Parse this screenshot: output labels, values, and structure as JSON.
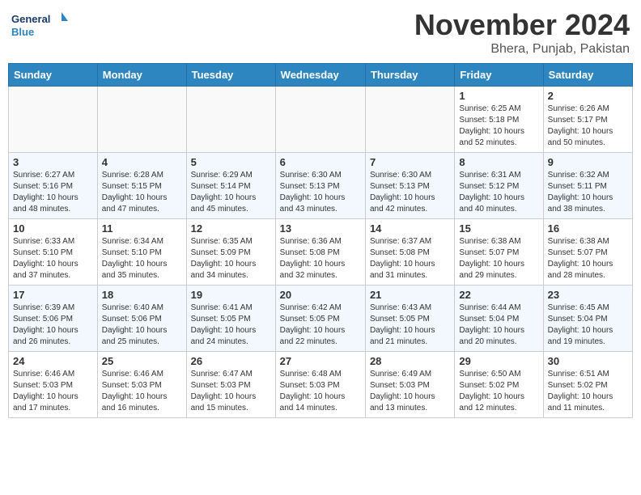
{
  "header": {
    "logo_general": "General",
    "logo_blue": "Blue",
    "month_title": "November 2024",
    "location": "Bhera, Punjab, Pakistan"
  },
  "days_of_week": [
    "Sunday",
    "Monday",
    "Tuesday",
    "Wednesday",
    "Thursday",
    "Friday",
    "Saturday"
  ],
  "weeks": [
    [
      {
        "day": "",
        "info": ""
      },
      {
        "day": "",
        "info": ""
      },
      {
        "day": "",
        "info": ""
      },
      {
        "day": "",
        "info": ""
      },
      {
        "day": "",
        "info": ""
      },
      {
        "day": "1",
        "info": "Sunrise: 6:25 AM\nSunset: 5:18 PM\nDaylight: 10 hours\nand 52 minutes."
      },
      {
        "day": "2",
        "info": "Sunrise: 6:26 AM\nSunset: 5:17 PM\nDaylight: 10 hours\nand 50 minutes."
      }
    ],
    [
      {
        "day": "3",
        "info": "Sunrise: 6:27 AM\nSunset: 5:16 PM\nDaylight: 10 hours\nand 48 minutes."
      },
      {
        "day": "4",
        "info": "Sunrise: 6:28 AM\nSunset: 5:15 PM\nDaylight: 10 hours\nand 47 minutes."
      },
      {
        "day": "5",
        "info": "Sunrise: 6:29 AM\nSunset: 5:14 PM\nDaylight: 10 hours\nand 45 minutes."
      },
      {
        "day": "6",
        "info": "Sunrise: 6:30 AM\nSunset: 5:13 PM\nDaylight: 10 hours\nand 43 minutes."
      },
      {
        "day": "7",
        "info": "Sunrise: 6:30 AM\nSunset: 5:13 PM\nDaylight: 10 hours\nand 42 minutes."
      },
      {
        "day": "8",
        "info": "Sunrise: 6:31 AM\nSunset: 5:12 PM\nDaylight: 10 hours\nand 40 minutes."
      },
      {
        "day": "9",
        "info": "Sunrise: 6:32 AM\nSunset: 5:11 PM\nDaylight: 10 hours\nand 38 minutes."
      }
    ],
    [
      {
        "day": "10",
        "info": "Sunrise: 6:33 AM\nSunset: 5:10 PM\nDaylight: 10 hours\nand 37 minutes."
      },
      {
        "day": "11",
        "info": "Sunrise: 6:34 AM\nSunset: 5:10 PM\nDaylight: 10 hours\nand 35 minutes."
      },
      {
        "day": "12",
        "info": "Sunrise: 6:35 AM\nSunset: 5:09 PM\nDaylight: 10 hours\nand 34 minutes."
      },
      {
        "day": "13",
        "info": "Sunrise: 6:36 AM\nSunset: 5:08 PM\nDaylight: 10 hours\nand 32 minutes."
      },
      {
        "day": "14",
        "info": "Sunrise: 6:37 AM\nSunset: 5:08 PM\nDaylight: 10 hours\nand 31 minutes."
      },
      {
        "day": "15",
        "info": "Sunrise: 6:38 AM\nSunset: 5:07 PM\nDaylight: 10 hours\nand 29 minutes."
      },
      {
        "day": "16",
        "info": "Sunrise: 6:38 AM\nSunset: 5:07 PM\nDaylight: 10 hours\nand 28 minutes."
      }
    ],
    [
      {
        "day": "17",
        "info": "Sunrise: 6:39 AM\nSunset: 5:06 PM\nDaylight: 10 hours\nand 26 minutes."
      },
      {
        "day": "18",
        "info": "Sunrise: 6:40 AM\nSunset: 5:06 PM\nDaylight: 10 hours\nand 25 minutes."
      },
      {
        "day": "19",
        "info": "Sunrise: 6:41 AM\nSunset: 5:05 PM\nDaylight: 10 hours\nand 24 minutes."
      },
      {
        "day": "20",
        "info": "Sunrise: 6:42 AM\nSunset: 5:05 PM\nDaylight: 10 hours\nand 22 minutes."
      },
      {
        "day": "21",
        "info": "Sunrise: 6:43 AM\nSunset: 5:05 PM\nDaylight: 10 hours\nand 21 minutes."
      },
      {
        "day": "22",
        "info": "Sunrise: 6:44 AM\nSunset: 5:04 PM\nDaylight: 10 hours\nand 20 minutes."
      },
      {
        "day": "23",
        "info": "Sunrise: 6:45 AM\nSunset: 5:04 PM\nDaylight: 10 hours\nand 19 minutes."
      }
    ],
    [
      {
        "day": "24",
        "info": "Sunrise: 6:46 AM\nSunset: 5:03 PM\nDaylight: 10 hours\nand 17 minutes."
      },
      {
        "day": "25",
        "info": "Sunrise: 6:46 AM\nSunset: 5:03 PM\nDaylight: 10 hours\nand 16 minutes."
      },
      {
        "day": "26",
        "info": "Sunrise: 6:47 AM\nSunset: 5:03 PM\nDaylight: 10 hours\nand 15 minutes."
      },
      {
        "day": "27",
        "info": "Sunrise: 6:48 AM\nSunset: 5:03 PM\nDaylight: 10 hours\nand 14 minutes."
      },
      {
        "day": "28",
        "info": "Sunrise: 6:49 AM\nSunset: 5:03 PM\nDaylight: 10 hours\nand 13 minutes."
      },
      {
        "day": "29",
        "info": "Sunrise: 6:50 AM\nSunset: 5:02 PM\nDaylight: 10 hours\nand 12 minutes."
      },
      {
        "day": "30",
        "info": "Sunrise: 6:51 AM\nSunset: 5:02 PM\nDaylight: 10 hours\nand 11 minutes."
      }
    ]
  ]
}
